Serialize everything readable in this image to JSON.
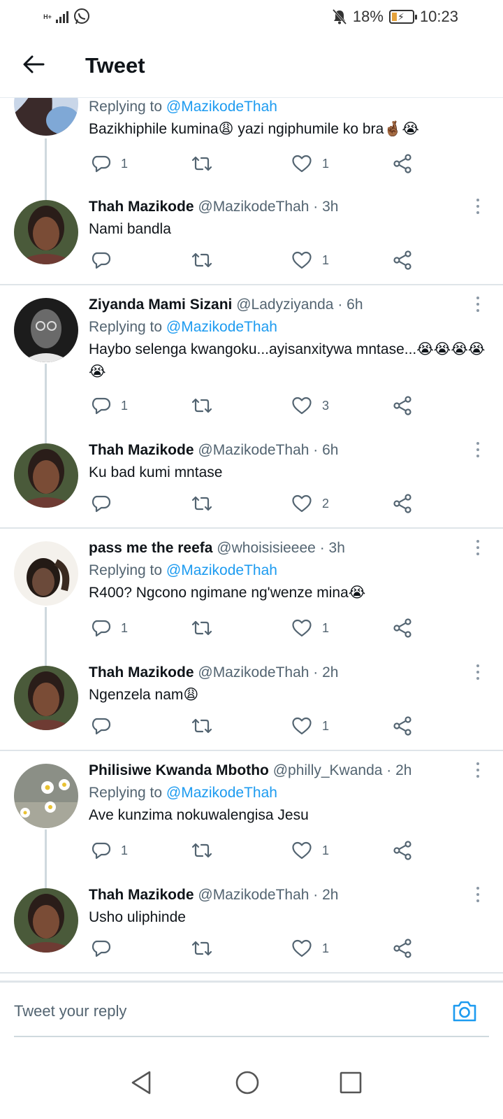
{
  "status_bar": {
    "network": "H+",
    "battery_percent": "18%",
    "time": "10:23"
  },
  "header": {
    "title": "Tweet"
  },
  "replying_prefix": "Replying to ",
  "reply_target": "@MazikodeThah",
  "tweets": [
    {
      "name": "",
      "handle": "",
      "time": "",
      "replying_to": true,
      "text": "Bazikhiphile kumina😩 yazi ngiphumile ko bra🤞🏾😭",
      "replies": "1",
      "retweets": "",
      "likes": "1"
    },
    {
      "name": "Thah Mazikode",
      "handle": "@MazikodeThah",
      "time": "· 3h",
      "replying_to": false,
      "text": "Nami bandla",
      "replies": "",
      "retweets": "",
      "likes": "1"
    },
    {
      "name": "Ziyanda Mami Sizani",
      "handle": "@Ladyziyanda",
      "time": "· 6h",
      "replying_to": true,
      "text": "Haybo selenga kwangoku...ayisanxitywa mntase...😭😭😭😭😭",
      "replies": "1",
      "retweets": "",
      "likes": "3"
    },
    {
      "name": "Thah Mazikode",
      "handle": "@MazikodeThah",
      "time": "· 6h",
      "replying_to": false,
      "text": "Ku bad kumi mntase",
      "replies": "",
      "retweets": "",
      "likes": "2"
    },
    {
      "name": "pass me the reefa",
      "handle": "@whoisisieeee",
      "time": "· 3h",
      "replying_to": true,
      "text": "R400? Ngcono ngimane ng'wenze mina😭",
      "replies": "1",
      "retweets": "",
      "likes": "1"
    },
    {
      "name": "Thah Mazikode",
      "handle": "@MazikodeThah",
      "time": "· 2h",
      "replying_to": false,
      "text": "Ngenzela nam😩",
      "replies": "",
      "retweets": "",
      "likes": "1"
    },
    {
      "name": "Philisiwe Kwanda Mbotho",
      "handle": "@philly_Kwanda",
      "time": "· 2h",
      "replying_to": true,
      "text": "Ave kunzima nokuwalengisa Jesu",
      "replies": "1",
      "retweets": "",
      "likes": "1"
    },
    {
      "name": "Thah Mazikode",
      "handle": "@MazikodeThah",
      "time": "· 2h",
      "replying_to": false,
      "text": "Usho uliphinde",
      "replies": "",
      "retweets": "",
      "likes": "1"
    }
  ],
  "reply_bar": {
    "placeholder": "Tweet your reply"
  },
  "colors": {
    "accent": "#1d9bf0",
    "text": "#0f1419",
    "secondary": "#536471",
    "divider": "#dfe5e9"
  }
}
